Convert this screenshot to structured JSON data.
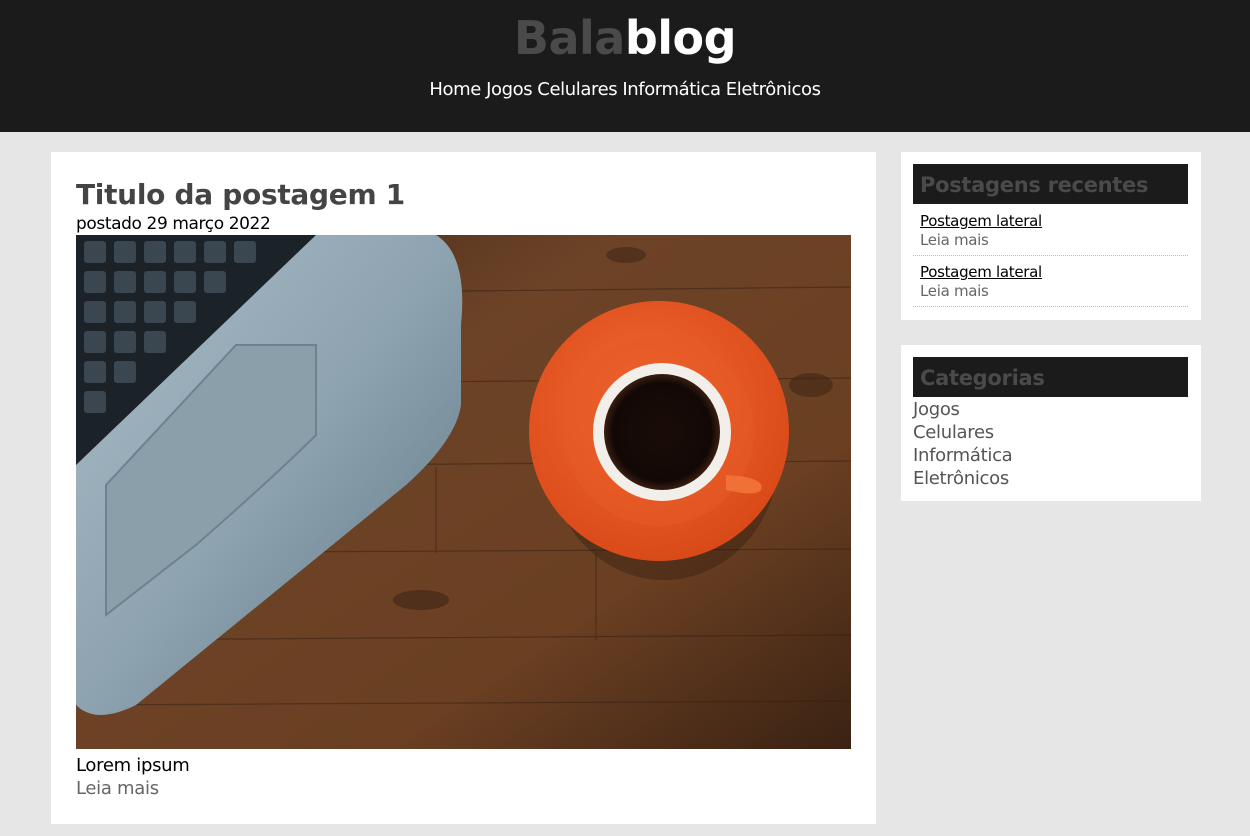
{
  "header": {
    "logo_part1": "Bala",
    "logo_part2": "blog",
    "nav": [
      "Home",
      "Jogos",
      "Celulares",
      "Informática",
      "Eletrônicos"
    ]
  },
  "post": {
    "title": "Titulo da postagem 1",
    "date": "postado 29 março 2022",
    "image": "laptop-and-coffee-photo",
    "excerpt": "Lorem ipsum",
    "read_more": "Leia mais"
  },
  "sidebar": {
    "recent": {
      "title": "Postagens recentes",
      "items": [
        {
          "title": "Postagem lateral",
          "more": "Leia mais"
        },
        {
          "title": "Postagem lateral",
          "more": "Leia mais"
        }
      ]
    },
    "categories": {
      "title": "Categorias",
      "items": [
        "Jogos",
        "Celulares",
        "Informática",
        "Eletrônicos"
      ]
    }
  },
  "colors": {
    "header_bg": "#1b1b1b",
    "page_bg": "#e6e6e6",
    "logo_dim": "#4a4a4a",
    "link_gray": "#666666"
  }
}
